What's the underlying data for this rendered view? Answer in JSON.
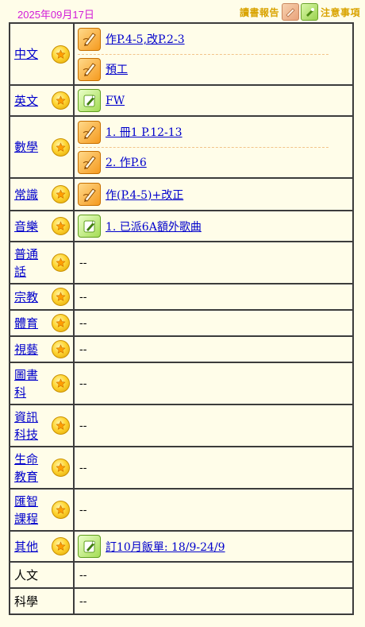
{
  "header": {
    "date": "2025年09月17日",
    "book_report_label": "讀書報告",
    "notice_label": "注意事項"
  },
  "rows": [
    {
      "subject": "中文",
      "linked": true,
      "tasks": [
        {
          "icon": "homework-pencil-icon",
          "text": "作P.4-5,改P.2-3"
        },
        {
          "icon": "homework-pencil-icon",
          "text": "預工"
        }
      ]
    },
    {
      "subject": "英文",
      "linked": true,
      "tasks": [
        {
          "icon": "notice-note-icon",
          "text": "FW"
        }
      ]
    },
    {
      "subject": "數學",
      "linked": true,
      "tasks": [
        {
          "icon": "homework-pencil-icon",
          "text": "1. 冊1 P.12-13"
        },
        {
          "icon": "homework-pencil-icon",
          "text": "2. 作P.6"
        }
      ]
    },
    {
      "subject": "常識",
      "linked": true,
      "tasks": [
        {
          "icon": "homework-pencil-icon",
          "text": "作(P.4-5)+改正"
        }
      ]
    },
    {
      "subject": "音樂",
      "linked": true,
      "tasks": [
        {
          "icon": "notice-note-icon",
          "text": "1. 已派6A額外歌曲"
        }
      ]
    },
    {
      "subject": "普通話",
      "subject_lines": [
        "普通",
        "話"
      ],
      "linked": true,
      "empty": "--"
    },
    {
      "subject": "宗教",
      "linked": true,
      "empty": "--"
    },
    {
      "subject": "體育",
      "linked": true,
      "empty": "--"
    },
    {
      "subject": "視藝",
      "linked": true,
      "empty": "--"
    },
    {
      "subject": "圖書科",
      "subject_lines": [
        "圖書",
        "科"
      ],
      "linked": true,
      "empty": "--"
    },
    {
      "subject": "資訊科技",
      "subject_lines": [
        "資訊",
        "科技"
      ],
      "linked": true,
      "empty": "--"
    },
    {
      "subject": "生命教育",
      "subject_lines": [
        "生命",
        "教育"
      ],
      "linked": true,
      "empty": "--"
    },
    {
      "subject": "匯智課程",
      "subject_lines": [
        "匯智",
        "課程"
      ],
      "linked": true,
      "empty": "--"
    },
    {
      "subject": "其他",
      "linked": true,
      "tasks": [
        {
          "icon": "notice-note-icon",
          "text": "訂10月飯單: 18/9-24/9"
        }
      ]
    },
    {
      "subject": "人文",
      "linked": false,
      "empty": "--"
    },
    {
      "subject": "科學",
      "linked": false,
      "empty": "--"
    }
  ]
}
